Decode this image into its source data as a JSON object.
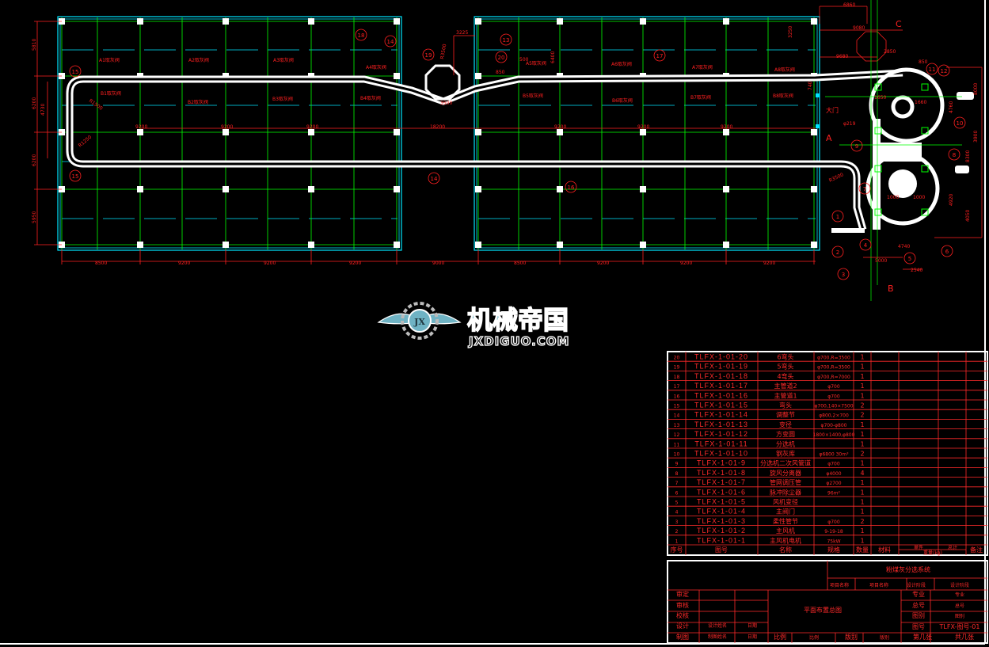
{
  "drawing": {
    "room_labels_top": [
      "A1取灰阀",
      "A2取灰阀",
      "A3取灰阀",
      "A4取灰阀",
      "A5取灰阀",
      "A6取灰阀",
      "A7取灰阀",
      "A8取灰阀"
    ],
    "room_labels_bottom": [
      "B1取灰阀",
      "B2取灰阀",
      "B3取灰阀",
      "B4取灰阀",
      "B5取灰阀",
      "B6取灰阀",
      "B7取灰阀",
      "B8取灰阀"
    ],
    "bottom_dims": [
      "8500",
      "9200",
      "9200",
      "9200",
      "9000",
      "8500",
      "9200",
      "9200",
      "9200"
    ],
    "middle_dims": [
      "9200",
      "9200",
      "9200",
      "18200",
      "9200",
      "9200",
      "9200"
    ],
    "left_dims": [
      "5810",
      "6200",
      "4730",
      "6200",
      "5950"
    ],
    "detail_dims": [
      "3225",
      "R3500",
      "6400",
      "850",
      "R1500",
      "R1250",
      "500",
      "3500",
      "3250",
      "740"
    ],
    "right_dims": [
      "6860",
      "9080",
      "9680",
      "2850",
      "850",
      "1650",
      "1660",
      "4760",
      "8000",
      "3900",
      "4920",
      "4050",
      "8300",
      "5000",
      "2540",
      "4740",
      "1000",
      "1000",
      "φ219",
      "R3500"
    ],
    "balloons": [
      "18",
      "14",
      "19",
      "13",
      "20",
      "17",
      "14",
      "16",
      "15",
      "15",
      "1",
      "2",
      "3",
      "4",
      "5",
      "6",
      "7",
      "8",
      "9",
      "10",
      "11",
      "12"
    ],
    "markers": {
      "c": "C",
      "a": "A",
      "b": "B",
      "gate": "大门"
    }
  },
  "logo": {
    "cn": "机械帝国",
    "en": "JXDIGUO.COM",
    "badge": "JX"
  },
  "parts_table": {
    "headers": {
      "no": "序号",
      "drawing_no": "图号",
      "name": "名称",
      "spec": "规格",
      "qty": "数量",
      "material": "材料",
      "unit": "单件",
      "total": "总计",
      "weight": "重量(kg)",
      "remark": "备注"
    },
    "rows": [
      {
        "no": "20",
        "drawing_no": "TLFX-1-01-20",
        "name": "6弯头",
        "spec": "φ700,R=3500",
        "qty": "1"
      },
      {
        "no": "19",
        "drawing_no": "TLFX-1-01-19",
        "name": "5弯头",
        "spec": "φ700,R=3500",
        "qty": "1"
      },
      {
        "no": "18",
        "drawing_no": "TLFX-1-01-18",
        "name": "4弯头",
        "spec": "φ700,R=7000",
        "qty": "1"
      },
      {
        "no": "17",
        "drawing_no": "TLFX-1-01-17",
        "name": "主管道2",
        "spec": "φ700",
        "qty": "1"
      },
      {
        "no": "16",
        "drawing_no": "TLFX-1-01-16",
        "name": "主管道1",
        "spec": "φ700",
        "qty": "1"
      },
      {
        "no": "15",
        "drawing_no": "TLFX-1-01-15",
        "name": "弯头",
        "spec": "φ700,140×7500",
        "qty": "2"
      },
      {
        "no": "14",
        "drawing_no": "TLFX-1-01-14",
        "name": "调整节",
        "spec": "φ800,2×700",
        "qty": "2"
      },
      {
        "no": "13",
        "drawing_no": "TLFX-1-01-13",
        "name": "变径",
        "spec": "φ700-φ800",
        "qty": "1"
      },
      {
        "no": "12",
        "drawing_no": "TLFX-1-01-12",
        "name": "方变圆",
        "spec": "1800×1400,φ800",
        "qty": "1"
      },
      {
        "no": "11",
        "drawing_no": "TLFX-1-01-11",
        "name": "分选机",
        "spec": "",
        "qty": "1"
      },
      {
        "no": "10",
        "drawing_no": "TLFX-1-01-10",
        "name": "钢灰库",
        "spec": "φ6800 30m³",
        "qty": "2"
      },
      {
        "no": "9",
        "drawing_no": "TLFX-1-01-9",
        "name": "分选机二次风管道",
        "spec": "φ700",
        "qty": "1"
      },
      {
        "no": "8",
        "drawing_no": "TLFX-1-01-8",
        "name": "旋风分离器",
        "spec": "φ4000",
        "qty": "4"
      },
      {
        "no": "7",
        "drawing_no": "TLFX-1-01-7",
        "name": "管网调压管",
        "spec": "φ2700",
        "qty": "1"
      },
      {
        "no": "6",
        "drawing_no": "TLFX-1-01-6",
        "name": "脉冲除尘器",
        "spec": "96m²",
        "qty": "1"
      },
      {
        "no": "5",
        "drawing_no": "TLFX-1-01-5",
        "name": "风机变径",
        "spec": "",
        "qty": "1"
      },
      {
        "no": "4",
        "drawing_no": "TLFX-1-01-4",
        "name": "主阀门",
        "spec": "",
        "qty": "1"
      },
      {
        "no": "3",
        "drawing_no": "TLFX-1-01-3",
        "name": "柔性管节",
        "spec": "φ700",
        "qty": "2"
      },
      {
        "no": "2",
        "drawing_no": "TLFX-1-01-2",
        "name": "主风机",
        "spec": "9-19-18",
        "qty": "1"
      },
      {
        "no": "1",
        "drawing_no": "TLFX-1-01-1",
        "name": "主风机电机",
        "spec": "75kW",
        "qty": "1"
      }
    ]
  },
  "title_block": {
    "system_name": "粉煤灰分选系统",
    "project_no_label": "项目名称",
    "project_name": "项目名称",
    "design_stage_label": "设计阶段",
    "design_stage": "设计阶段",
    "drawing_title": "平面布置总图",
    "approve": "审定",
    "review": "审核",
    "check": "校核",
    "design": "设计",
    "designer": "设计姓名",
    "design_date": "日期",
    "draw": "制图",
    "drafter": "制图姓名",
    "draw_date": "日期",
    "scale_label": "比例",
    "scale": "比例",
    "edition_label": "版别",
    "edition": "版别",
    "discipline_label": "专业",
    "discipline": "专业",
    "general_no_label": "总号",
    "general_no": "总号",
    "category_label": "图别",
    "category": "图别",
    "drawing_no_label": "图号",
    "drawing_no": "TLFX-图号-01",
    "sheet": "第几张",
    "total_sheets": "共几张"
  },
  "colors": {
    "background": "#000000",
    "grid": "#00ff00",
    "wall": "#00e5ff",
    "annotation": "#ff2020",
    "duct": "#ffffff"
  }
}
